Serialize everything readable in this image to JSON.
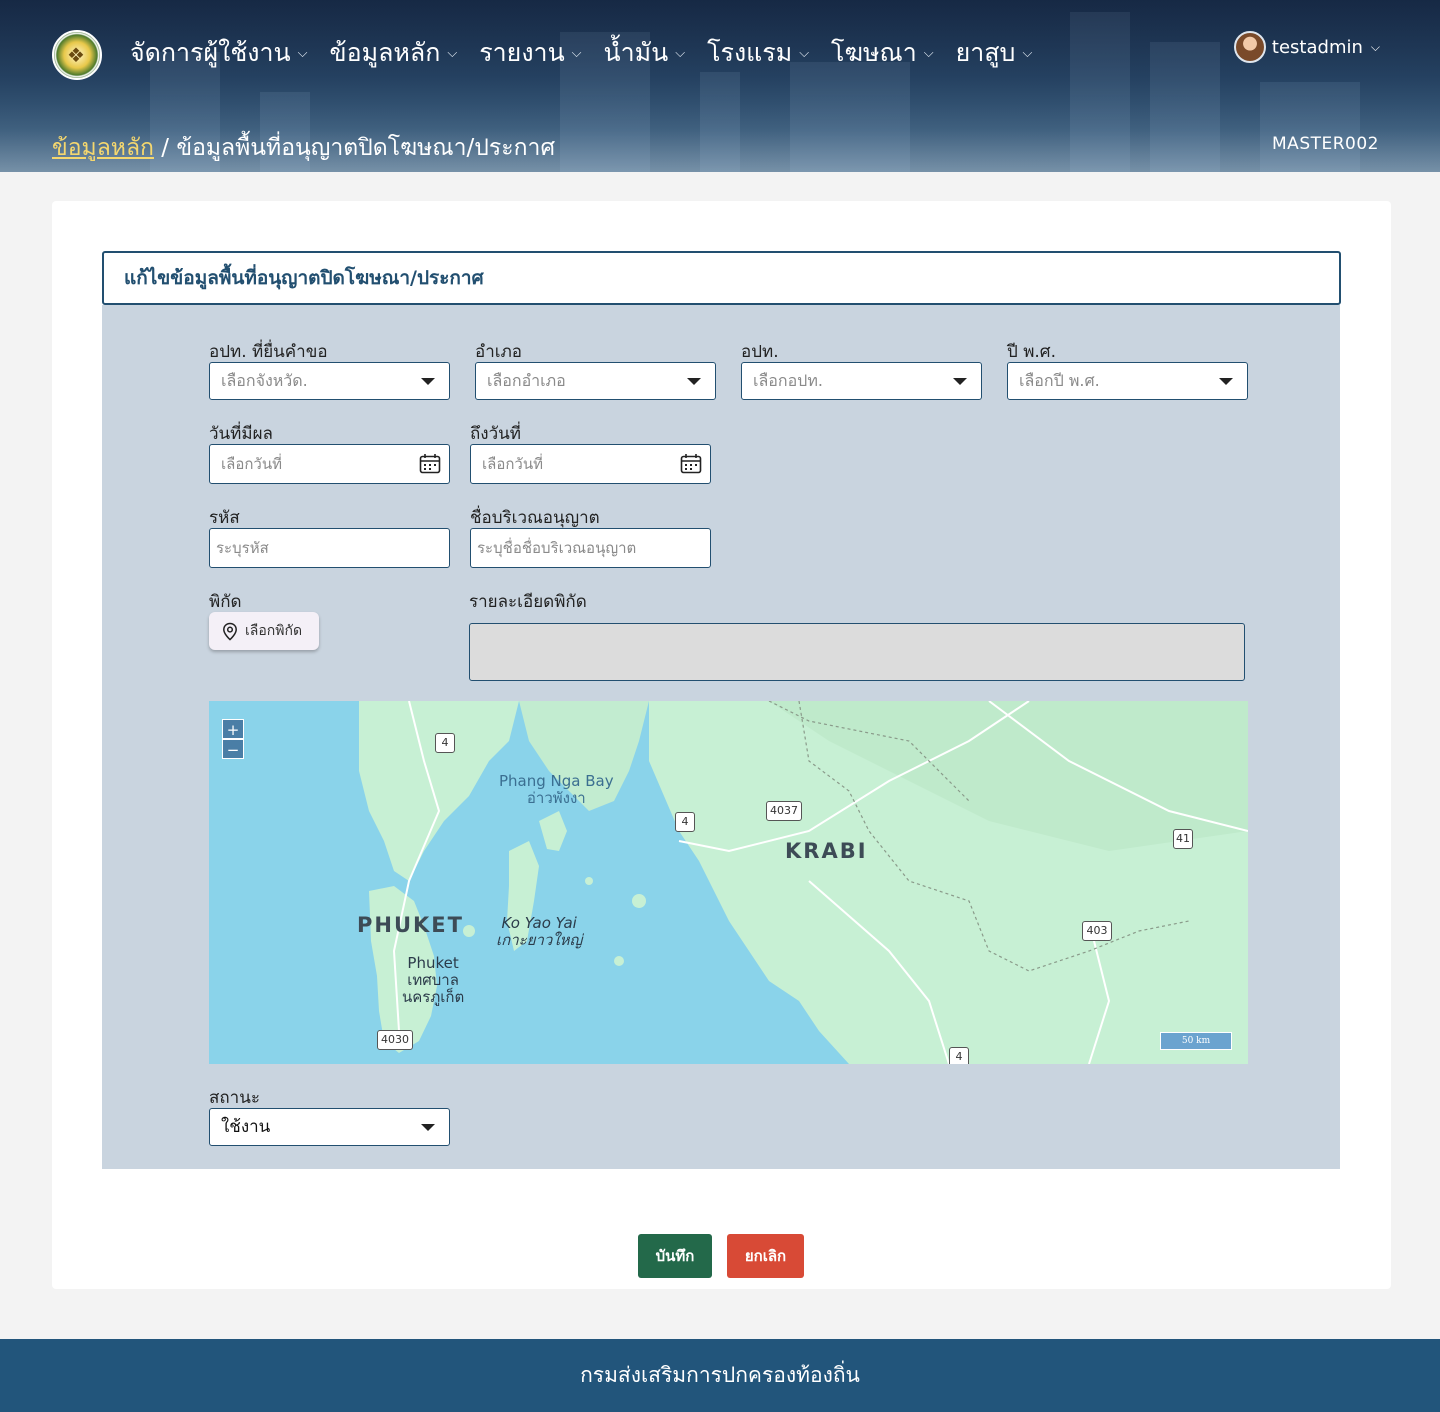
{
  "header": {
    "nav": [
      {
        "label": "จัดการผู้ใช้งาน"
      },
      {
        "label": "ข้อมูลหลัก"
      },
      {
        "label": "รายงาน"
      },
      {
        "label": "น้ำมัน"
      },
      {
        "label": "โรงแรม"
      },
      {
        "label": "โฆษณา"
      },
      {
        "label": "ยาสูบ"
      }
    ],
    "user": "testadmin",
    "breadcrumb": {
      "link": "ข้อมูลหลัก",
      "current": " / ข้อมูลพื้นที่อนุญาตปิดโฆษณา/ประกาศ"
    },
    "page_code": "MASTER002"
  },
  "form": {
    "title": "แก้ไขข้อมูลพื้นที่อนุญาตปิดโฆษณา/ประกาศ",
    "province_label": "อปท. ที่ยื่นคำขอ",
    "province_placeholder": "เลือกจังหวัด.",
    "district_label": "อำเภอ",
    "district_placeholder": "เลือกอำเภอ",
    "lao_label": "อปท.",
    "lao_placeholder": "เลือกอปท.",
    "year_label": "ปี พ.ศ.",
    "year_placeholder": "เลือกปี พ.ศ.",
    "start_date_label": "วันที่มีผล",
    "start_date_placeholder": "เลือกวันที่",
    "end_date_label": "ถึงวันที่",
    "end_date_placeholder": "เลือกวันที่",
    "code_label": "รหัส",
    "code_placeholder": "ระบุรหัส",
    "area_name_label": "ชื่อบริเวณอนุญาต",
    "area_name_placeholder": "ระบุชื่อชื่อบริเวณอนุญาต",
    "coord_label": "พิกัด",
    "coord_button": "เลือกพิกัด",
    "coord_detail_label": "รายละเอียดพิกัด",
    "status_label": "สถานะ",
    "status_value": "ใช้งาน"
  },
  "map": {
    "zoom_in": "+",
    "zoom_out": "−",
    "labels": {
      "bay_en": "Phang Nga Bay",
      "bay_th": "อ่าวพังงา",
      "krabi": "KRABI",
      "phuket": "PHUKET",
      "koyao_en": "Ko Yao Yai",
      "koyao_th": "เกาะยาวใหญ่",
      "phuket_city_1": "Phuket",
      "phuket_city_2": "เทศบาล",
      "phuket_city_3": "นครภูเก็ต"
    },
    "routes": {
      "r4a": "4",
      "r4b": "4",
      "r4c": "4",
      "r4037": "4037",
      "r41": "41",
      "r403": "403",
      "r4030": "4030"
    },
    "scale": "50 km"
  },
  "actions": {
    "save": "บันทึก",
    "cancel": "ยกเลิก"
  },
  "footer": {
    "text": "กรมส่งเสริมการปกครองท้องถิ่น"
  },
  "colors": {
    "primary": "#224f70",
    "save": "#23694a",
    "cancel": "#d84a36",
    "panel": "#c9d4df",
    "footer": "#22557b"
  }
}
